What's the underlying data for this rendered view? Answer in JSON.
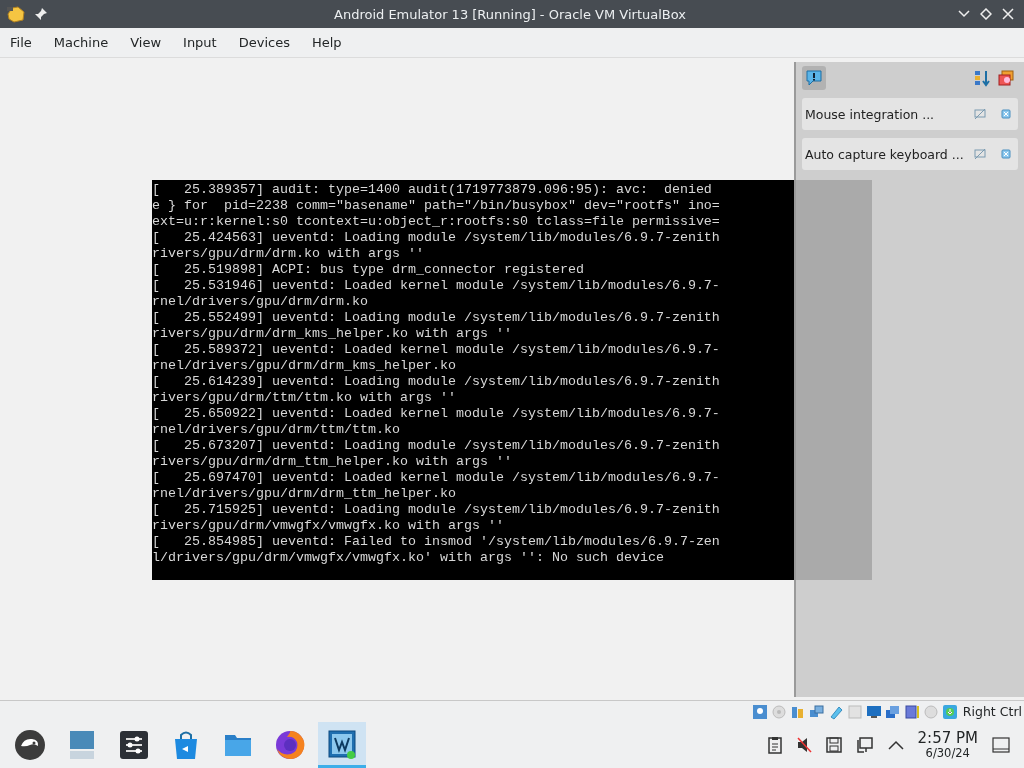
{
  "window": {
    "title": "Android Emulator 13 [Running] - Oracle VM VirtualBox"
  },
  "menu": [
    "File",
    "Machine",
    "View",
    "Input",
    "Devices",
    "Help"
  ],
  "guest_console": {
    "lines": [
      "[   25.389357] audit: type=1400 audit(1719773879.096:95): avc:  denied",
      "e } for  pid=2238 comm=\"basename\" path=\"/bin/busybox\" dev=\"rootfs\" ino=",
      "ext=u:r:kernel:s0 tcontext=u:object_r:rootfs:s0 tclass=file permissive=",
      "[   25.424563] ueventd: Loading module /system/lib/modules/6.9.7-zenith",
      "rivers/gpu/drm/drm.ko with args ''",
      "[   25.519898] ACPI: bus type drm_connector registered",
      "[   25.531946] ueventd: Loaded kernel module /system/lib/modules/6.9.7-",
      "rnel/drivers/gpu/drm/drm.ko",
      "[   25.552499] ueventd: Loading module /system/lib/modules/6.9.7-zenith",
      "rivers/gpu/drm/drm_kms_helper.ko with args ''",
      "[   25.589372] ueventd: Loaded kernel module /system/lib/modules/6.9.7-",
      "rnel/drivers/gpu/drm/drm_kms_helper.ko",
      "[   25.614239] ueventd: Loading module /system/lib/modules/6.9.7-zenith",
      "rivers/gpu/drm/ttm/ttm.ko with args ''",
      "[   25.650922] ueventd: Loaded kernel module /system/lib/modules/6.9.7-",
      "rnel/drivers/gpu/drm/ttm/ttm.ko",
      "[   25.673207] ueventd: Loading module /system/lib/modules/6.9.7-zenith",
      "rivers/gpu/drm/drm_ttm_helper.ko with args ''",
      "[   25.697470] ueventd: Loaded kernel module /system/lib/modules/6.9.7-",
      "rnel/drivers/gpu/drm/drm_ttm_helper.ko",
      "[   25.715925] ueventd: Loading module /system/lib/modules/6.9.7-zenith",
      "rivers/gpu/drm/vmwgfx/vmwgfx.ko with args ''",
      "[   25.854985] ueventd: Failed to insmod '/system/lib/modules/6.9.7-zen",
      "l/drivers/gpu/drm/vmwgfx/vmwgfx.ko' with args '': No such device"
    ]
  },
  "notification_panel": {
    "items": [
      {
        "text": "Mouse integration ..."
      },
      {
        "text": "Auto capture keyboard ..."
      }
    ]
  },
  "status_bar": {
    "host_key": "Right Ctrl"
  },
  "taskbar": {
    "apps": [
      {
        "kind": "logo",
        "selected": false
      },
      {
        "kind": "pager",
        "selected": false
      },
      {
        "kind": "settings",
        "selected": false
      },
      {
        "kind": "store",
        "selected": false
      },
      {
        "kind": "files",
        "selected": false
      },
      {
        "kind": "browser",
        "selected": false
      },
      {
        "kind": "vbox",
        "selected": true
      }
    ],
    "clock": {
      "time": "2:57 PM",
      "date": "6/30/24"
    }
  }
}
